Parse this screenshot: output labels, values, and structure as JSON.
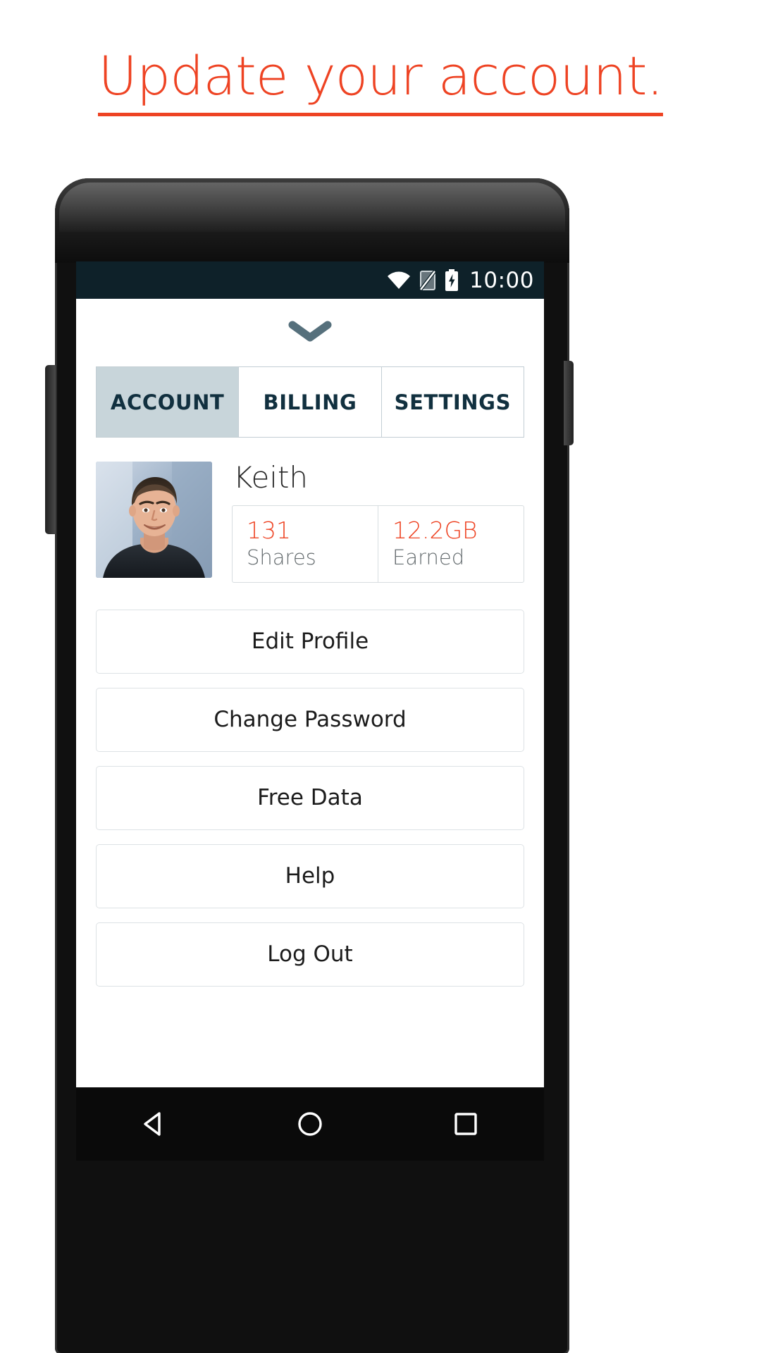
{
  "headline": {
    "text": "Update your account.",
    "color": "#ee4323"
  },
  "status_bar": {
    "time": "10:00",
    "icons": [
      "wifi-icon",
      "sim-no-signal-icon",
      "battery-charging-icon"
    ]
  },
  "app": {
    "collapse_chevron": "chevron-down-icon",
    "tabs": [
      {
        "label": "ACCOUNT",
        "active": true
      },
      {
        "label": "BILLING",
        "active": false
      },
      {
        "label": "SETTINGS",
        "active": false
      }
    ],
    "profile": {
      "avatar": "user-photo",
      "name": "Keith",
      "stats": [
        {
          "value": "131",
          "label": "Shares"
        },
        {
          "value": "12.2GB",
          "label": "Earned"
        }
      ]
    },
    "actions": [
      {
        "label": "Edit Profile"
      },
      {
        "label": "Change Password"
      },
      {
        "label": "Free Data"
      },
      {
        "label": "Help"
      },
      {
        "label": "Log Out"
      }
    ]
  },
  "nav_bar": {
    "buttons": [
      "back-triangle-icon",
      "home-circle-icon",
      "recents-square-icon"
    ]
  },
  "colors": {
    "accent": "#ee4323",
    "tab_active_bg": "#c8d5da",
    "tab_text": "#11303f",
    "status_bar_bg": "#0e2129"
  }
}
